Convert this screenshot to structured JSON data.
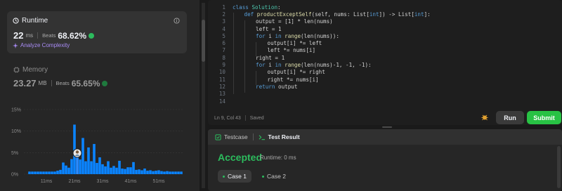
{
  "runtime": {
    "title": "Runtime",
    "value": "22",
    "unit": "ms",
    "beats_label": "Beats",
    "beats_pct": "68.62%",
    "analyze_label": "Analyze Complexity"
  },
  "memory": {
    "title": "Memory",
    "value": "23.27",
    "unit": "MB",
    "beats_label": "Beats",
    "beats_pct": "65.65%"
  },
  "chart_data": {
    "type": "bar",
    "yticks": [
      "15%",
      "10%",
      "5%",
      "0%"
    ],
    "ylim": [
      0,
      15
    ],
    "xlim": [
      4,
      60
    ],
    "xticks": [
      "11ms",
      "21ms",
      "31ms",
      "41ms",
      "51ms"
    ],
    "xtick_values": [
      11,
      21,
      31,
      41,
      51
    ],
    "bar_width_ms": 0.9,
    "x": [
      5,
      6,
      7,
      8,
      9,
      10,
      11,
      12,
      13,
      14,
      15,
      16,
      17,
      18,
      19,
      20,
      21,
      22,
      23,
      24,
      25,
      26,
      27,
      28,
      29,
      30,
      31,
      32,
      33,
      34,
      35,
      36,
      37,
      38,
      39,
      40,
      41,
      42,
      43,
      44,
      45,
      46,
      47,
      48,
      49,
      50,
      51,
      52,
      53,
      54,
      55,
      56,
      57,
      58,
      59
    ],
    "values": [
      0.6,
      0.6,
      0.6,
      0.6,
      0.6,
      0.6,
      0.6,
      0.6,
      0.6,
      0.6,
      0.8,
      1.0,
      2.7,
      2.0,
      1.5,
      3.5,
      11.5,
      5.0,
      3.4,
      8.4,
      3.0,
      6.2,
      3.0,
      7.0,
      2.6,
      3.9,
      2.3,
      1.8,
      3.0,
      1.5,
      1.9,
      1.5,
      3.1,
      1.3,
      1.2,
      1.6,
      1.6,
      2.8,
      1.0,
      1.1,
      0.9,
      1.3,
      0.8,
      0.9,
      0.7,
      0.8,
      0.9,
      0.7,
      0.6,
      0.7,
      0.6,
      0.6,
      0.6,
      0.6,
      0.6
    ],
    "highlight_x": 22,
    "grid": true,
    "bar_color": "#0a84ff"
  },
  "editor": {
    "lines": [
      {
        "n": "1",
        "indent": 0,
        "tokens": [
          [
            "kw",
            "class "
          ],
          [
            "cls",
            "Solution"
          ],
          [
            "p",
            ":"
          ]
        ]
      },
      {
        "n": "2",
        "indent": 1,
        "tokens": [
          [
            "kw",
            "def "
          ],
          [
            "fn",
            "productExceptSelf"
          ],
          [
            "p",
            "(self, nums: List["
          ],
          [
            "kw",
            "int"
          ],
          [
            "p",
            "]) -> List["
          ],
          [
            "kw",
            "int"
          ],
          [
            "p",
            "]:"
          ]
        ]
      },
      {
        "n": "3",
        "indent": 2,
        "tokens": [
          [
            "p",
            "output = [1] * len(nums)"
          ]
        ]
      },
      {
        "n": "4",
        "indent": 2,
        "tokens": [
          [
            "p",
            "left = 1"
          ]
        ]
      },
      {
        "n": "5",
        "indent": 2,
        "tokens": [
          [
            "kw",
            "for "
          ],
          [
            "p",
            "i "
          ],
          [
            "kw",
            "in "
          ],
          [
            "bi",
            "range"
          ],
          [
            "p",
            "(len(nums)):"
          ]
        ]
      },
      {
        "n": "6",
        "indent": 3,
        "tokens": [
          [
            "p",
            "output[i] *= left"
          ]
        ]
      },
      {
        "n": "7",
        "indent": 3,
        "tokens": [
          [
            "p",
            "left *= nums[i]"
          ]
        ]
      },
      {
        "n": "8",
        "indent": 2,
        "tokens": [
          [
            "p",
            "right = 1"
          ]
        ]
      },
      {
        "n": "9",
        "indent": 2,
        "tokens": [
          [
            "kw",
            "for "
          ],
          [
            "p",
            "i "
          ],
          [
            "kw",
            "in "
          ],
          [
            "bi",
            "range"
          ],
          [
            "p",
            "(len(nums)-1, -1, -1):"
          ]
        ]
      },
      {
        "n": "10",
        "indent": 3,
        "tokens": [
          [
            "p",
            "output[i] *= right"
          ]
        ]
      },
      {
        "n": "11",
        "indent": 3,
        "tokens": [
          [
            "p",
            "right *= nums[i]"
          ]
        ]
      },
      {
        "n": "12",
        "indent": 2,
        "tokens": [
          [
            "kw",
            "return "
          ],
          [
            "p",
            "output"
          ]
        ]
      },
      {
        "n": "13",
        "indent": 0,
        "tokens": []
      },
      {
        "n": "14",
        "indent": 0,
        "tokens": []
      }
    ],
    "status_position": "Ln 9, Col 43",
    "status_saved": "Saved",
    "run_label": "Run",
    "submit_label": "Submit"
  },
  "result": {
    "testcase_tab": "Testcase",
    "testresult_tab": "Test Result",
    "verdict": "Accepted",
    "runtime_text": "Runtime: 0 ms",
    "cases": [
      "Case 1",
      "Case 2"
    ]
  },
  "colors": {
    "accent_green": "#2cbb5d",
    "submit_green": "#28c244",
    "keyword": "#569cd6",
    "class_name": "#4ec9b0",
    "function": "#dcdcaa",
    "analyze_purple": "#a98cf6"
  }
}
